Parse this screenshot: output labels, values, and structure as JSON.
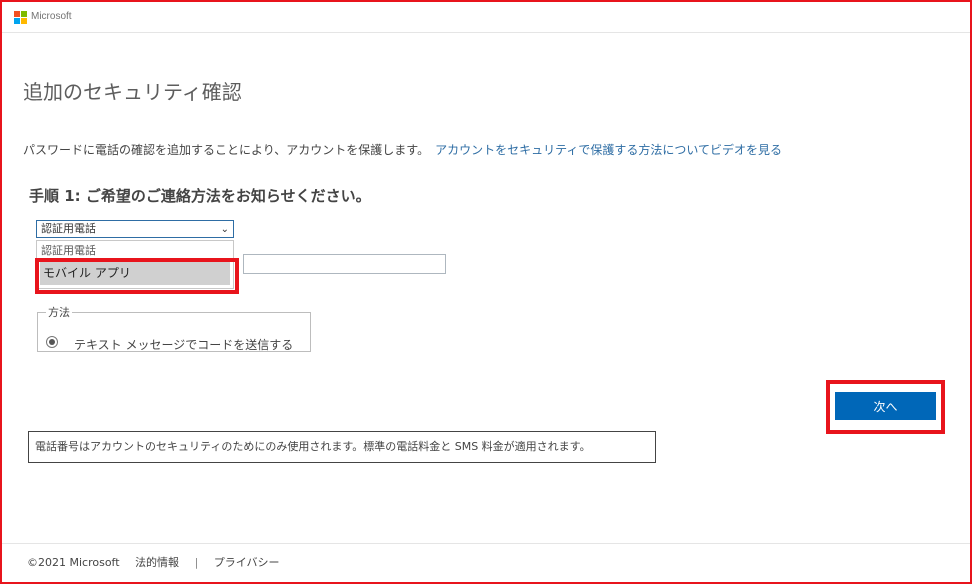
{
  "brand": {
    "logo_text": "Microsoft",
    "logo_colors": [
      "#f25022",
      "#7fba00",
      "#00a4ef",
      "#ffb900"
    ]
  },
  "page": {
    "title": "追加のセキュリティ確認",
    "description": "パスワードに電話の確認を追加することにより、アカウントを保護します。",
    "video_link": "アカウントをセキュリティで保護する方法についてビデオを見る",
    "step_heading": "手順 1: ご希望のご連絡方法をお知らせください。"
  },
  "contact_select": {
    "selected": "認証用電話",
    "options": [
      "認証用電話",
      "モバイル アプリ"
    ],
    "highlighted": "モバイル アプリ"
  },
  "phone_input": {
    "value": ""
  },
  "method": {
    "legend": "方法",
    "option_label": "テキスト メッセージでコードを送信する"
  },
  "next_button": {
    "label": "次へ"
  },
  "notice": "電話番号はアカウントのセキュリティのためにのみ使用されます。標準の電話料金と SMS 料金が適用されます。",
  "footer": {
    "copyright": "©2021 Microsoft",
    "legal": "法的情報",
    "separator": "|",
    "privacy": "プライバシー"
  },
  "colors": {
    "accent": "#0067b8",
    "highlight": "#e8141c",
    "link": "#2e6da4"
  }
}
